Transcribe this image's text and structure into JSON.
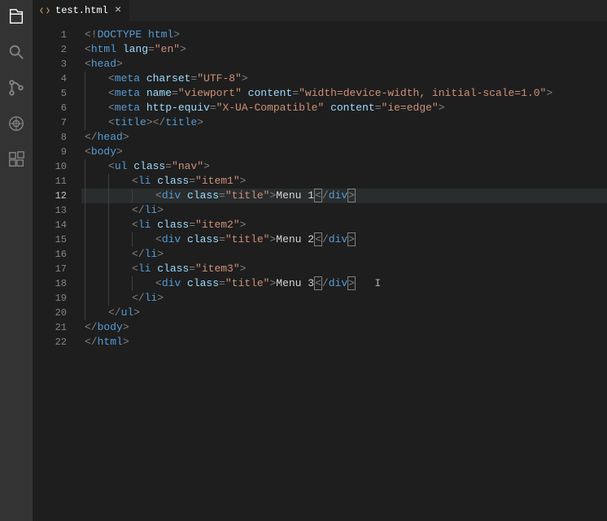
{
  "activity_bar": {
    "explorer": "files-icon",
    "search": "search-icon",
    "scm": "git-icon",
    "debug": "bug-icon",
    "extensions": "extensions-icon"
  },
  "tab": {
    "filename": "test.html",
    "close": "×"
  },
  "gutter": {
    "start": 1,
    "end": 22,
    "highlighted": 12
  },
  "code": {
    "l1": {
      "seg": [
        [
          "p",
          "<!"
        ],
        [
          "dt",
          "DOCTYPE "
        ],
        [
          "t",
          "html"
        ],
        [
          "p",
          ">"
        ]
      ]
    },
    "l2": {
      "seg": [
        [
          "p",
          "<"
        ],
        [
          "t",
          "html "
        ],
        [
          "a",
          "lang"
        ],
        [
          "p",
          "="
        ],
        [
          "s",
          "\"en\""
        ],
        [
          "p",
          ">"
        ]
      ]
    },
    "l3": {
      "seg": [
        [
          "p",
          "<"
        ],
        [
          "t",
          "head"
        ],
        [
          "p",
          ">"
        ]
      ]
    },
    "l4": {
      "seg": [
        [
          "p",
          "<"
        ],
        [
          "t",
          "meta "
        ],
        [
          "a",
          "charset"
        ],
        [
          "p",
          "="
        ],
        [
          "s",
          "\"UTF-8\""
        ],
        [
          "p",
          ">"
        ]
      ]
    },
    "l5": {
      "seg": [
        [
          "p",
          "<"
        ],
        [
          "t",
          "meta "
        ],
        [
          "a",
          "name"
        ],
        [
          "p",
          "="
        ],
        [
          "s",
          "\"viewport\""
        ],
        [
          "a",
          " content"
        ],
        [
          "p",
          "="
        ],
        [
          "s",
          "\"width=device-width, initial-scale=1.0\""
        ],
        [
          "p",
          ">"
        ]
      ]
    },
    "l6": {
      "seg": [
        [
          "p",
          "<"
        ],
        [
          "t",
          "meta "
        ],
        [
          "a",
          "http-equiv"
        ],
        [
          "p",
          "="
        ],
        [
          "s",
          "\"X-UA-Compatible\""
        ],
        [
          "a",
          " content"
        ],
        [
          "p",
          "="
        ],
        [
          "s",
          "\"ie=edge\""
        ],
        [
          "p",
          ">"
        ]
      ]
    },
    "l7": {
      "seg": [
        [
          "p",
          "<"
        ],
        [
          "t",
          "title"
        ],
        [
          "p",
          "></"
        ],
        [
          "t",
          "title"
        ],
        [
          "p",
          ">"
        ]
      ]
    },
    "l8": {
      "seg": [
        [
          "p",
          "</"
        ],
        [
          "t",
          "head"
        ],
        [
          "p",
          ">"
        ]
      ]
    },
    "l9": {
      "seg": [
        [
          "p",
          "<"
        ],
        [
          "t",
          "body"
        ],
        [
          "p",
          ">"
        ]
      ]
    },
    "l10": {
      "seg": [
        [
          "p",
          "<"
        ],
        [
          "t",
          "ul "
        ],
        [
          "a",
          "class"
        ],
        [
          "p",
          "="
        ],
        [
          "s",
          "\"nav\""
        ],
        [
          "p",
          ">"
        ]
      ]
    },
    "l11": {
      "seg": [
        [
          "p",
          "<"
        ],
        [
          "t",
          "li "
        ],
        [
          "a",
          "class"
        ],
        [
          "p",
          "="
        ],
        [
          "s",
          "\"item1\""
        ],
        [
          "p",
          ">"
        ]
      ]
    },
    "l12": {
      "seg": [
        [
          "p",
          "<"
        ],
        [
          "t",
          "div "
        ],
        [
          "a",
          "class"
        ],
        [
          "p",
          "="
        ],
        [
          "s",
          "\"title\""
        ],
        [
          "p",
          ">"
        ],
        [
          "tx",
          "Menu 1"
        ],
        [
          "box",
          "<"
        ],
        [
          "p",
          "/"
        ],
        [
          "t",
          "div"
        ],
        [
          "box",
          ">"
        ]
      ]
    },
    "l13": {
      "seg": [
        [
          "p",
          "</"
        ],
        [
          "t",
          "li"
        ],
        [
          "p",
          ">"
        ]
      ]
    },
    "l14": {
      "seg": [
        [
          "p",
          "<"
        ],
        [
          "t",
          "li "
        ],
        [
          "a",
          "class"
        ],
        [
          "p",
          "="
        ],
        [
          "s",
          "\"item2\""
        ],
        [
          "p",
          ">"
        ]
      ]
    },
    "l15": {
      "seg": [
        [
          "p",
          "<"
        ],
        [
          "t",
          "div "
        ],
        [
          "a",
          "class"
        ],
        [
          "p",
          "="
        ],
        [
          "s",
          "\"title\""
        ],
        [
          "p",
          ">"
        ],
        [
          "tx",
          "Menu 2"
        ],
        [
          "box",
          "<"
        ],
        [
          "p",
          "/"
        ],
        [
          "t",
          "div"
        ],
        [
          "box",
          ">"
        ]
      ]
    },
    "l16": {
      "seg": [
        [
          "p",
          "</"
        ],
        [
          "t",
          "li"
        ],
        [
          "p",
          ">"
        ]
      ]
    },
    "l17": {
      "seg": [
        [
          "p",
          "<"
        ],
        [
          "t",
          "li "
        ],
        [
          "a",
          "class"
        ],
        [
          "p",
          "="
        ],
        [
          "s",
          "\"item3\""
        ],
        [
          "p",
          ">"
        ]
      ]
    },
    "l18": {
      "seg": [
        [
          "p",
          "<"
        ],
        [
          "t",
          "div "
        ],
        [
          "a",
          "class"
        ],
        [
          "p",
          "="
        ],
        [
          "s",
          "\"title\""
        ],
        [
          "p",
          ">"
        ],
        [
          "tx",
          "Menu 3"
        ],
        [
          "box",
          "<"
        ],
        [
          "p",
          "/"
        ],
        [
          "t",
          "div"
        ],
        [
          "box",
          ">"
        ]
      ]
    },
    "l19": {
      "seg": [
        [
          "p",
          "</"
        ],
        [
          "t",
          "li"
        ],
        [
          "p",
          ">"
        ]
      ]
    },
    "l20": {
      "seg": [
        [
          "p",
          "</"
        ],
        [
          "t",
          "ul"
        ],
        [
          "p",
          ">"
        ]
      ]
    },
    "l21": {
      "seg": [
        [
          "p",
          "</"
        ],
        [
          "t",
          "body"
        ],
        [
          "p",
          ">"
        ]
      ]
    },
    "l22": {
      "seg": [
        [
          "p",
          "</"
        ],
        [
          "t",
          "html"
        ],
        [
          "p",
          ">"
        ]
      ]
    }
  },
  "indents": {
    "l1": 0,
    "l2": 0,
    "l3": 0,
    "l4": 1,
    "l5": 1,
    "l6": 1,
    "l7": 1,
    "l8": 0,
    "l9": 0,
    "l10": 1,
    "l11": 2,
    "l12": 3,
    "l13": 2,
    "l14": 2,
    "l15": 3,
    "l16": 2,
    "l17": 2,
    "l18": 3,
    "l19": 2,
    "l20": 1,
    "l21": 0,
    "l22": 0
  },
  "guides": {
    "l4": [
      0
    ],
    "l5": [
      0
    ],
    "l6": [
      0
    ],
    "l7": [
      0
    ],
    "l10": [
      0
    ],
    "l11": [
      0,
      1
    ],
    "l12": [
      0,
      1,
      2
    ],
    "l13": [
      0,
      1
    ],
    "l14": [
      0,
      1
    ],
    "l15": [
      0,
      1,
      2
    ],
    "l16": [
      0,
      1
    ],
    "l17": [
      0,
      1
    ],
    "l18": [
      0,
      1,
      2
    ],
    "l19": [
      0,
      1
    ],
    "l20": [
      0
    ]
  },
  "cursor": {
    "line": 18,
    "after": true
  }
}
